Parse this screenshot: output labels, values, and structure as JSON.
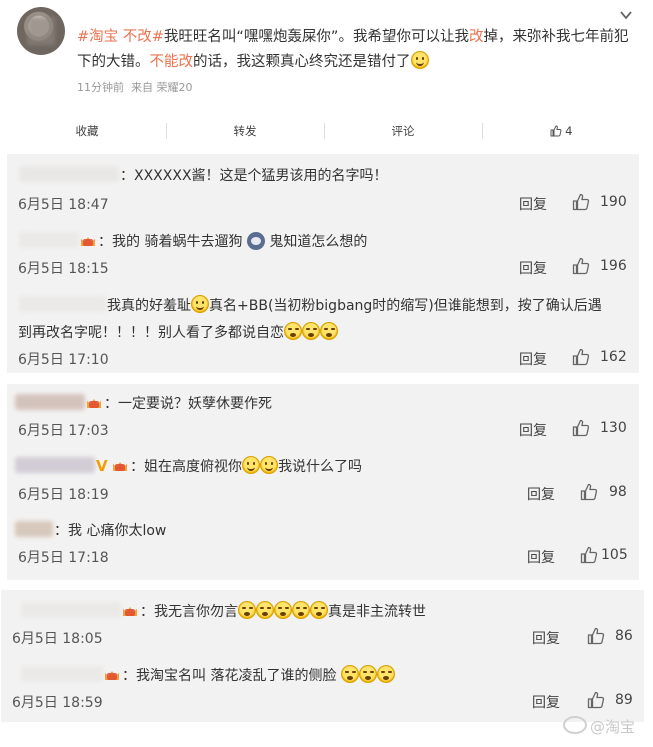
{
  "post": {
    "tag1": "#淘宝",
    "tag2": "不改",
    "tag3": "#",
    "text_a": "我旺旺名叫“嘿嘿炮轰屎你”。我希望你可以让我",
    "hl1": "改",
    "text_b": "掉，来弥补我七年前犯下的大错。",
    "hl2": "不能改",
    "text_c": "的话，我这颗真心终究还是错付了",
    "time": "11分钟前",
    "source": "来自 荣耀20",
    "actions": {
      "collect": "收藏",
      "repost": "转发",
      "comment": "评论",
      "like": "4"
    }
  },
  "group1": [
    {
      "text": "：XXXXXX酱！这是个猛男该用的名字吗！",
      "date": "6月5日 18:47",
      "reply": "回复",
      "likes": "190"
    },
    {
      "text_a": "：我的 骑着蜗牛去遛狗",
      "text_b": " 鬼知道怎么想的",
      "date": "6月5日 18:15",
      "reply": "回复",
      "likes": "196"
    },
    {
      "line1_a": "我真的好羞耻",
      "line1_b": "真名+BB(当初粉bigbang时的缩写)但谁能想到，按了确认后遇",
      "line2": "到再改名字呢！！！！别人看了多都说自恋",
      "date": "6月5日 17:10",
      "reply": "回复",
      "likes": "162"
    }
  ],
  "group2": [
    {
      "text": "：一定要说？妖孽休要作死",
      "date": "6月5日 17:03",
      "reply": "回复",
      "likes": "130"
    },
    {
      "vmark": "V",
      "text_a": "：姐在高度俯视你",
      "text_b": "我说什么了吗",
      "date": "6月5日 18:19",
      "reply": "回复",
      "likes": "98"
    },
    {
      "text": "：我 心痛你太low",
      "date": "6月5日 17:18",
      "reply": "回复",
      "likes": "105"
    }
  ],
  "group3": [
    {
      "text_a": "：我无言你勿言",
      "text_b": "真是非主流转世",
      "date": "6月5日 18:05",
      "reply": "回复",
      "likes": "86"
    },
    {
      "text_a": "：我淘宝名叫 落花凌乱了谁的侧脸",
      "date": "6月5日 18:59",
      "reply": "回复",
      "likes": "89"
    }
  ],
  "watermark": "@淘宝"
}
